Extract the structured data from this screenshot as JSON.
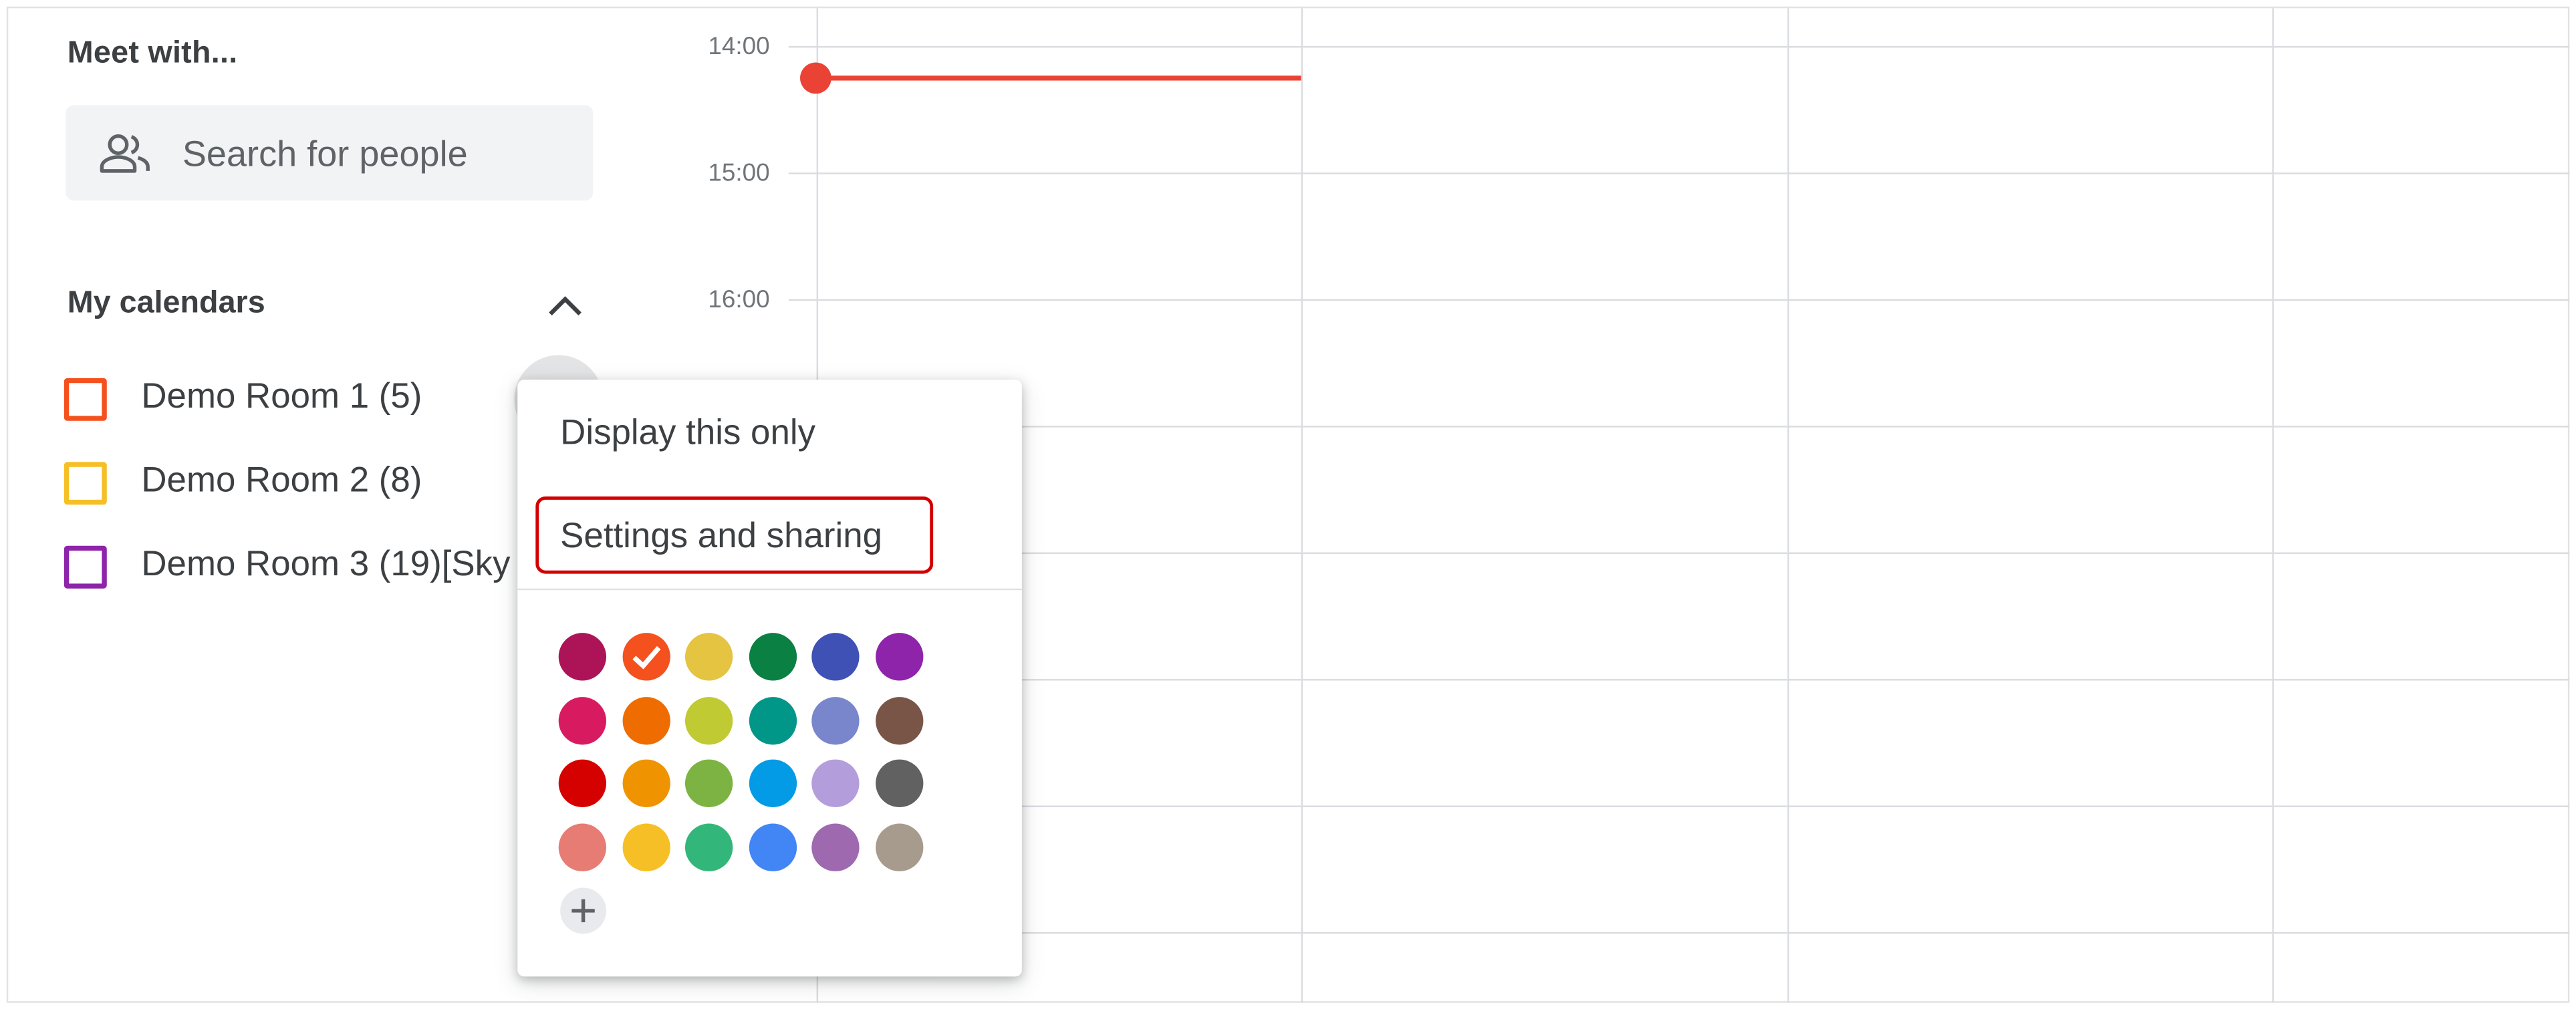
{
  "sidebar": {
    "meet_with_title": "Meet with...",
    "search_placeholder": "Search for people",
    "search_icon": "people-icon",
    "my_calendars_title": "My calendars",
    "collapse_icon": "chevron-up-icon",
    "calendars": [
      {
        "label": "Demo Room 1 (5)",
        "color": "#f4511e"
      },
      {
        "label": "Demo Room 2 (8)",
        "color": "#f6bf26"
      },
      {
        "label": "Demo Room 3 (19)[Sky",
        "color": "#8e24aa"
      }
    ]
  },
  "grid": {
    "times": [
      "14:00",
      "15:00",
      "16:00"
    ],
    "now_indicator_color": "#ea4335"
  },
  "context_menu": {
    "display_only_label": "Display this only",
    "settings_label": "Settings and sharing",
    "selected_color": "#f4511e",
    "colors": [
      [
        "#ad1457",
        "#f4511e",
        "#e4c441",
        "#0b8043",
        "#3f51b5",
        "#8e24aa"
      ],
      [
        "#d81b60",
        "#ef6c00",
        "#c0ca33",
        "#009688",
        "#7986cb",
        "#795548"
      ],
      [
        "#d50000",
        "#f09300",
        "#7cb342",
        "#039be5",
        "#b39ddb",
        "#616161"
      ],
      [
        "#e67c73",
        "#f6bf26",
        "#33b679",
        "#4285f4",
        "#9e69af",
        "#a79b8e"
      ]
    ],
    "add_color_icon": "plus-icon"
  }
}
